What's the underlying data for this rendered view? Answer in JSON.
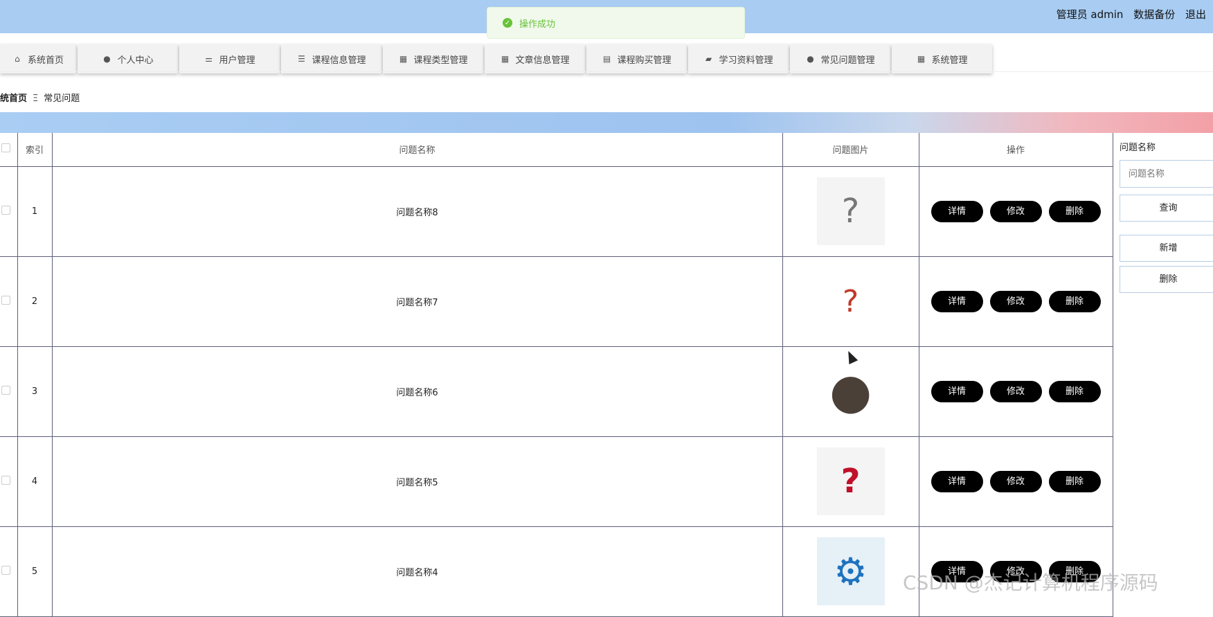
{
  "header": {
    "user": "管理员 admin",
    "backup": "数据备份",
    "logout": "退出"
  },
  "toast": {
    "message": "操作成功"
  },
  "nav": [
    {
      "label": "系统首页",
      "icon": "home-icon",
      "glyph": "⌂"
    },
    {
      "label": "个人中心",
      "icon": "user-icon",
      "glyph": "●"
    },
    {
      "label": "用户管理",
      "icon": "sliders-icon",
      "glyph": "⚌"
    },
    {
      "label": "课程信息管理",
      "icon": "list-icon",
      "glyph": "☰"
    },
    {
      "label": "课程类型管理",
      "icon": "grid-icon",
      "glyph": "▦"
    },
    {
      "label": "文章信息管理",
      "icon": "apps-icon",
      "glyph": "▦"
    },
    {
      "label": "课程购买管理",
      "icon": "chart-icon",
      "glyph": "▤"
    },
    {
      "label": "学习资料管理",
      "icon": "ticket-icon",
      "glyph": "▰"
    },
    {
      "label": "常见问题管理",
      "icon": "user-icon",
      "glyph": "●"
    },
    {
      "label": "系统管理",
      "icon": "grid-icon",
      "glyph": "▦"
    }
  ],
  "breadcrumb": {
    "home": "统首页",
    "sep": "Ξ",
    "current": "常见问题"
  },
  "table": {
    "headers": {
      "index": "索引",
      "name": "问题名称",
      "image": "问题图片",
      "actions": "操作"
    },
    "rows": [
      {
        "index": "1",
        "name": "问题名称8",
        "img_icon": "person-question-sketch-image",
        "img_glyph": "?"
      },
      {
        "index": "2",
        "name": "问题名称7",
        "img_icon": "confused-man-image",
        "img_glyph": "?"
      },
      {
        "index": "3",
        "name": "问题名称6",
        "img_icon": "dark-circle-image",
        "img_glyph": "●"
      },
      {
        "index": "4",
        "name": "问题名称5",
        "img_icon": "question-mark-people-image",
        "img_glyph": "?"
      },
      {
        "index": "5",
        "name": "问题名称4",
        "img_icon": "gear-person-image",
        "img_glyph": "⚙"
      }
    ],
    "actions": {
      "detail": "详情",
      "edit": "修改",
      "delete": "删除"
    }
  },
  "search": {
    "label": "问题名称",
    "placeholder": "问题名称",
    "query_btn": "查询",
    "add_btn": "新增",
    "delete_btn": "删除"
  },
  "watermark": "CSDN @杰记计算机程序源码",
  "colors": {
    "topbar": "#a8ccf2",
    "toast_text": "#67c23a",
    "action_btn": "#000000"
  }
}
